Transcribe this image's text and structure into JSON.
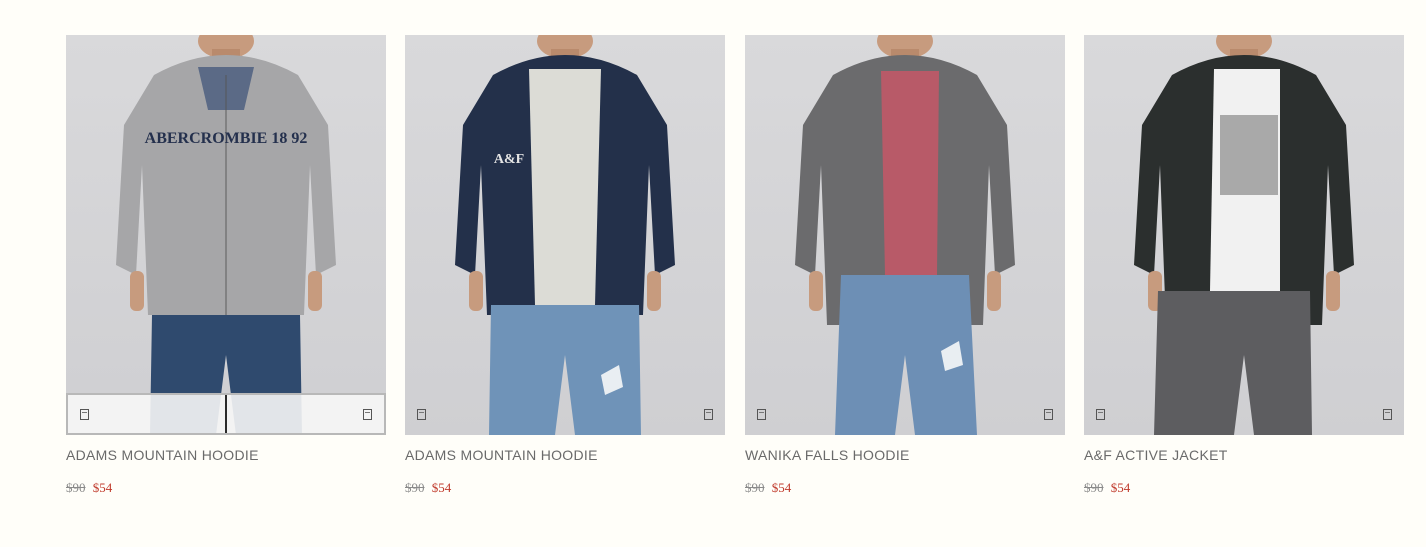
{
  "products": [
    {
      "name": "ADAMS MOUNTAIN HOODIE",
      "old_price": "$90",
      "sale_price": "$54",
      "hoodie_color": "#a6a6a8",
      "shirt_color": "#5b6a86",
      "jeans_color": "#2f4a6e",
      "print_text": "ABERCROMBIE 18 92",
      "hovered": true
    },
    {
      "name": "ADAMS MOUNTAIN HOODIE",
      "old_price": "$90",
      "sale_price": "$54",
      "hoodie_color": "#23304a",
      "shirt_color": "#dcdcd6",
      "jeans_color": "#6f93b8",
      "print_text": "A&F",
      "hovered": false
    },
    {
      "name": "WANIKA FALLS HOODIE",
      "old_price": "$90",
      "sale_price": "$54",
      "hoodie_color": "#6b6b6d",
      "shirt_color": "#b85a68",
      "jeans_color": "#6d8fb5",
      "print_text": "",
      "hovered": false
    },
    {
      "name": "A&F ACTIVE JACKET",
      "old_price": "$90",
      "sale_price": "$54",
      "hoodie_color": "#2b2f2e",
      "shirt_color": "#f1f1f1",
      "jeans_color": "#5d5d60",
      "print_text": "",
      "hovered": false
    }
  ],
  "colors": {
    "page_background": "#fffef9",
    "sale_price": "#c0392b",
    "old_price": "#8a8a8a",
    "name_text": "#6a6a6a"
  },
  "icons": {
    "quick_view": "quick-view-icon",
    "wishlist": "wishlist-icon"
  }
}
